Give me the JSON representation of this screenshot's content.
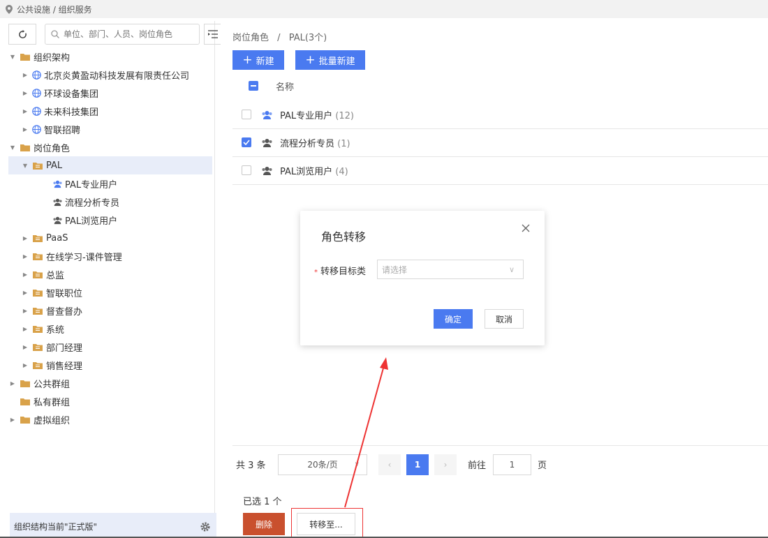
{
  "breadcrumb_top": "公共设施 / 组织服务",
  "search": {
    "placeholder": "单位、部门、人员、岗位角色"
  },
  "tree": {
    "org_root": "组织架构",
    "companies": [
      "北京炎黄盈动科技发展有限责任公司",
      "环球设备集团",
      "未来科技集团",
      "智联招聘"
    ],
    "roles_root": "岗位角色",
    "pal": "PAL",
    "pal_children": [
      "PAL专业用户",
      "流程分析专员",
      "PAL浏览用户"
    ],
    "role_groups": [
      "PaaS",
      "在线学习-课件管理",
      "总监",
      "智联职位",
      "督查督办",
      "系统",
      "部门经理",
      "销售经理"
    ],
    "public_group": "公共群组",
    "private_group": "私有群组",
    "virtual_org": "虚拟组织"
  },
  "left_footer": "组织结构当前\"正式版\"",
  "main": {
    "crumb_role": "岗位角色",
    "crumb_sep": "/",
    "crumb_current": "PAL(3个)",
    "new_label": "新建",
    "batch_new_label": "批量新建",
    "col_name": "名称",
    "rows": [
      {
        "name": "PAL专业用户",
        "count": "(12)",
        "checked": false
      },
      {
        "name": "流程分析专员",
        "count": "(1)",
        "checked": true
      },
      {
        "name": "PAL浏览用户",
        "count": "(4)",
        "checked": false
      }
    ],
    "total_text": "共 3 条",
    "page_size": "20条/页",
    "current_page": "1",
    "goto_label": "前往",
    "goto_value": "1",
    "page_unit": "页",
    "selected_text": "已选 1 个",
    "delete_label": "删除",
    "move_label": "转移至..."
  },
  "modal": {
    "title": "角色转移",
    "field_label": "转移目标类",
    "select_placeholder": "请选择",
    "ok_label": "确定",
    "cancel_label": "取消"
  },
  "colors": {
    "accent": "#4a7af0",
    "danger": "#c9502e",
    "folder": "#d9a24a",
    "highlight_box": "#e33333"
  }
}
